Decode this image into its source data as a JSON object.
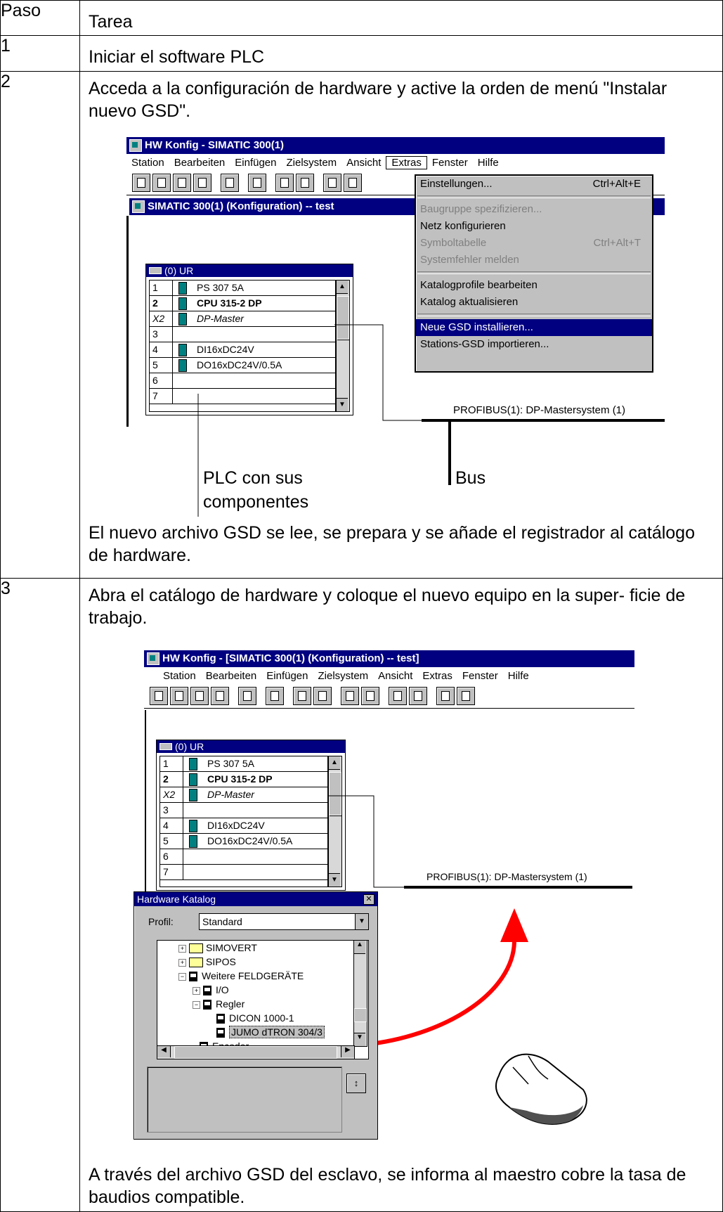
{
  "table": {
    "header": {
      "col1": "Paso",
      "col2": "Tarea"
    },
    "rows": [
      {
        "step": "1",
        "task": "Iniciar el software PLC"
      },
      {
        "step": "2",
        "task": "Acceda a la configuración de hardware y active la orden de menú \"Instalar nuevo GSD\".",
        "note": "El nuevo archivo GSD se lee, se prepara y se añade el registrador al catálogo de hardware."
      },
      {
        "step": "3",
        "task": "Abra el catálogo de hardware y coloque el nuevo equipo en la super- ficie de trabajo.",
        "note": "A través del archivo GSD del esclavo, se informa al maestro cobre la tasa de baudios compatible."
      }
    ]
  },
  "shot1": {
    "title": "HW Konfig - SIMATIC 300(1)",
    "menu": [
      "Station",
      "Bearbeiten",
      "Einfügen",
      "Zielsystem",
      "Ansicht",
      "Extras",
      "Fenster",
      "Hilfe"
    ],
    "subtitle": "SIMATIC 300(1) (Konfiguration) -- test",
    "rack_title": "(0) UR",
    "rack_rows": [
      {
        "slot": "1",
        "module": "PS 307 5A"
      },
      {
        "slot": "2",
        "module": "CPU 315-2 DP"
      },
      {
        "slot": "X2",
        "module": "DP-Master"
      },
      {
        "slot": "3",
        "module": ""
      },
      {
        "slot": "4",
        "module": "DI16xDC24V"
      },
      {
        "slot": "5",
        "module": "DO16xDC24V/0.5A"
      },
      {
        "slot": "6",
        "module": ""
      },
      {
        "slot": "7",
        "module": ""
      }
    ],
    "extras_menu": [
      {
        "label": "Einstellungen...",
        "shortcut": "Ctrl+Alt+E"
      },
      {
        "label": "Baugruppe spezifizieren...",
        "shortcut": ""
      },
      {
        "label": "Netz konfigurieren",
        "shortcut": ""
      },
      {
        "label": "Symboltabelle",
        "shortcut": "Ctrl+Alt+T"
      },
      {
        "label": "Systemfehler melden",
        "shortcut": ""
      },
      {
        "label": "Katalogprofile bearbeiten",
        "shortcut": ""
      },
      {
        "label": "Katalog aktualisieren",
        "shortcut": ""
      },
      {
        "label": "Neue GSD installieren...",
        "shortcut": ""
      },
      {
        "label": "Stations-GSD importieren...",
        "shortcut": ""
      }
    ],
    "bus_label": "PROFIBUS(1): DP-Mastersystem (1)",
    "callout_plc": "PLC con sus componentes",
    "callout_plc_l1": "PLC con sus",
    "callout_plc_l2": "componentes",
    "callout_bus": "Bus"
  },
  "shot2": {
    "title": "HW Konfig - [SIMATIC 300(1) (Konfiguration) -- test]",
    "menu": [
      "Station",
      "Bearbeiten",
      "Einfügen",
      "Zielsystem",
      "Ansicht",
      "Extras",
      "Fenster",
      "Hilfe"
    ],
    "rack_title": "(0) UR",
    "bus_label": "PROFIBUS(1): DP-Mastersystem (1)",
    "catalog_title": "Hardware Katalog",
    "profil_label": "Profil:",
    "profil_value": "Standard",
    "tree": [
      "SIMOVERT",
      "SIPOS",
      "Weitere FELDGERÄTE",
      "I/O",
      "Regler",
      "DICON 1000-1",
      "JUMO dTRON 304/3",
      "Encoder"
    ]
  },
  "colors": {
    "titlebar": "#000080",
    "arrow": "#ff0000"
  }
}
